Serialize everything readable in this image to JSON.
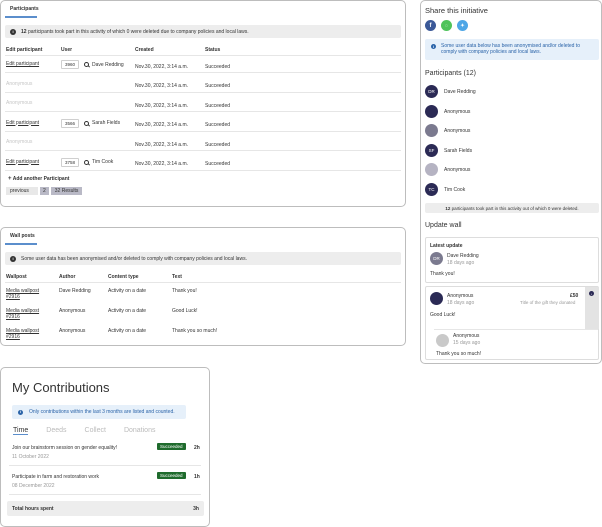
{
  "participants": {
    "tab": "Participants",
    "info": "12 participants took part in this activity of which 0 were deleted due to company policies and local laws.",
    "info_bold": "12",
    "columns": [
      "Edit participant",
      "User",
      "Created",
      "Status"
    ],
    "rows": [
      {
        "edit": "Edit participant",
        "id": "3960",
        "user": "Dave Redding",
        "created": "Nov.30, 2022, 3:14 a.m.",
        "status": "Succeeded",
        "anon": false
      },
      {
        "edit": "Anonymous",
        "id": "",
        "user": "",
        "created": "Nov.30, 2022, 3:14 a.m.",
        "status": "Succeeded",
        "anon": true
      },
      {
        "edit": "Anonymous",
        "id": "",
        "user": "",
        "created": "Nov.30, 2022, 3:14 a.m.",
        "status": "Succeeded",
        "anon": true
      },
      {
        "edit": "Edit participant",
        "id": "3566",
        "user": "Sarah Fields",
        "created": "Nov.30, 2022, 3:14 a.m.",
        "status": "Succeeded",
        "anon": false
      },
      {
        "edit": "Anonymous",
        "id": "",
        "user": "",
        "created": "Nov.30, 2022, 3:14 a.m.",
        "status": "Succeeded",
        "anon": true
      },
      {
        "edit": "Edit participant",
        "id": "3758",
        "user": "Tim Cook",
        "created": "Nov.30, 2022, 3:14 a.m.",
        "status": "Succeeded",
        "anon": false
      }
    ],
    "add_link": "Add another Participant",
    "pager": {
      "previous": "previous",
      "page": "2",
      "results": "32 Results"
    }
  },
  "wall": {
    "tab": "Wall posts",
    "info": "Some user data has been anonymised and/or deleted to comply with company policies and local laws.",
    "columns": [
      "Wallpost",
      "Author",
      "Content type",
      "Text"
    ],
    "rows": [
      {
        "post_line1": "Media wallpost",
        "post_line2": "#2916",
        "author": "Dave Redding",
        "type": "Activity on a date",
        "text": "Thank you!"
      },
      {
        "post_line1": "Media wallpost",
        "post_line2": "#2916",
        "author": "Anonymous",
        "type": "Activity on a date",
        "text": "Good Luck!"
      },
      {
        "post_line1": "Media wallpost",
        "post_line2": "#2916",
        "author": "Anonymous",
        "type": "Activity on a date",
        "text": "Thank you so much!"
      }
    ]
  },
  "share": {
    "title": "Share this initiative",
    "icons": [
      "facebook-icon",
      "whatsapp-icon",
      "twitter-icon"
    ],
    "info": "Some user data below has been anonymised and/or deleted to comply with company policies and local laws.",
    "participants_title": "Participants (12)",
    "people": [
      {
        "initials": "DR",
        "name": "Dave Redding",
        "color": "#2b2a55"
      },
      {
        "initials": "",
        "name": "Anonymous",
        "color": "#2b2a55"
      },
      {
        "initials": "",
        "name": "Anonymous",
        "color": "#7b7a8f"
      },
      {
        "initials": "SF",
        "name": "Sarah Fields",
        "color": "#2b2a55"
      },
      {
        "initials": "",
        "name": "Anonymous",
        "color": "#b5b3c2"
      },
      {
        "initials": "TC",
        "name": "Tim Cook",
        "color": "#2b2a55"
      }
    ],
    "summary": "12 participants took part in this activity out of which 0 were deleted.",
    "summary_bold": "12"
  },
  "update": {
    "title": "Update wall",
    "latest": "Latest update",
    "post1": {
      "initials": "DR",
      "author": "Dave Redding",
      "time": "18 days ago",
      "text": "Thank you!"
    },
    "post2": {
      "author": "Anonymous",
      "time": "18 days ago",
      "amount": "£50",
      "gift": "Title of the gift they donated",
      "text": "Good Luck!"
    },
    "reply": {
      "author": "Anonymous",
      "time": "15 days ago",
      "text": "Thank you so much!"
    }
  },
  "contrib": {
    "title": "My Contributions",
    "info": "Only contributions within the last 3 months are listed and counted.",
    "tabs": [
      "Time",
      "Deeds",
      "Collect",
      "Donations"
    ],
    "items": [
      {
        "title": "Join our brainstorm session on gender equality!",
        "date": "11 October 2022",
        "status": "Succeeded",
        "hours": "2h"
      },
      {
        "title": "Participate in farm and restoration work",
        "date": "08 December 2022",
        "status": "Succeeded",
        "hours": "1h"
      }
    ],
    "total_label": "Total hours spent",
    "total_value": "3h"
  },
  "colors": {
    "accent": "#5b8ecc",
    "success": "#1f6b2d",
    "info_blue": "#2a63a8",
    "facebook": "#3b5998",
    "whatsapp": "#4fc35b",
    "twitter": "#4ea6e6"
  }
}
